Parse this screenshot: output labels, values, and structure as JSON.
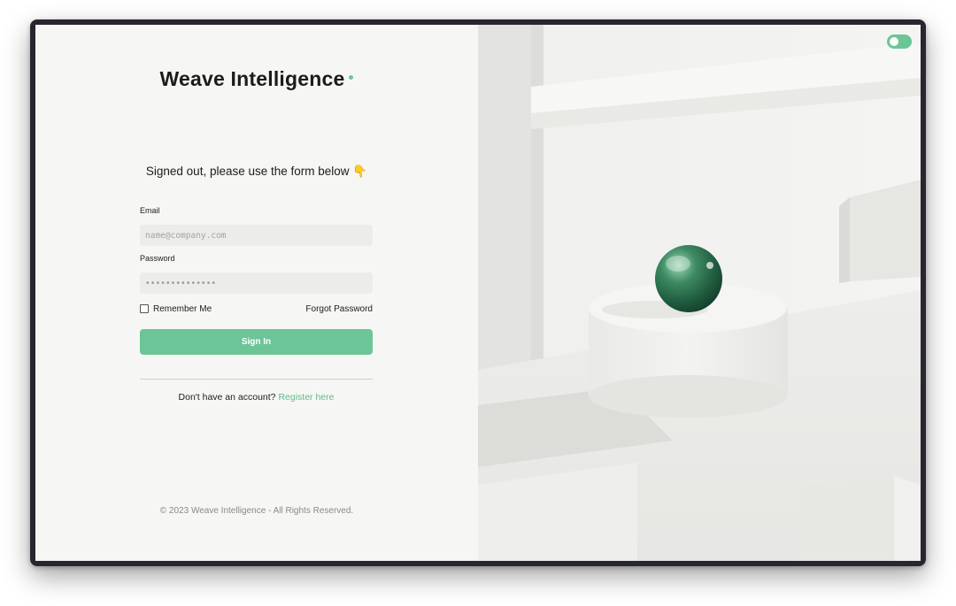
{
  "brand": {
    "name": "Weave Intelligence",
    "accent_color": "#6cc597"
  },
  "auth": {
    "heading": "Signed out, please use the form below 👇",
    "email_label": "Email",
    "email_placeholder": "name@company.com",
    "password_label": "Password",
    "password_value": "••••••••••••••",
    "remember_label": "Remember Me",
    "remember_checked": false,
    "forgot_label": "Forgot Password",
    "signin_label": "Sign In",
    "no_account_text": "Don't have an account?",
    "register_label": "Register here"
  },
  "footer": {
    "copyright": "© 2023 Weave Intelligence - All Rights Reserved."
  },
  "theme_toggle": {
    "icon": "toggle-switch-icon",
    "state": "on"
  }
}
